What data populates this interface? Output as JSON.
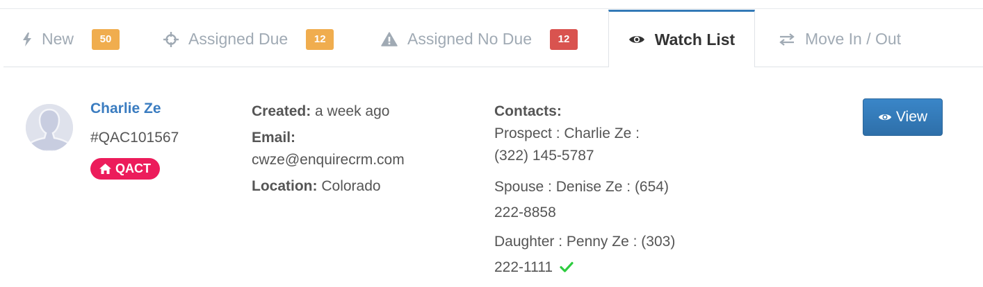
{
  "tabs": [
    {
      "label": "New",
      "icon": "bolt-icon",
      "badge": "50",
      "badge_color": "#f0ad4e"
    },
    {
      "label": "Assigned Due",
      "icon": "crosshairs-icon",
      "badge": "12",
      "badge_color": "#f0ad4e"
    },
    {
      "label": "Assigned No Due",
      "icon": "warning-icon",
      "badge": "12",
      "badge_color": "#d9534f"
    },
    {
      "label": "Watch List",
      "icon": "eye-icon",
      "active": true
    },
    {
      "label": "Move In / Out",
      "icon": "exchange-icon"
    }
  ],
  "record": {
    "name": "Charlie Ze",
    "code": "#QAC101567",
    "tag": "QACT",
    "tag_icon": "home-icon",
    "tag_color": "#ec1c5b",
    "created_label": "Created:",
    "created_value": "a week ago",
    "email_label": "Email:",
    "email_value": "cwze@enquirecrm.com",
    "location_label": "Location:",
    "location_value": "Colorado",
    "contacts_label": "Contacts:",
    "contacts": [
      {
        "line1": "Prospect : Charlie Ze :",
        "line2": "(322) 145-5787"
      },
      {
        "line1": "Spouse : Denise Ze : (654)",
        "line2": "222-8858"
      },
      {
        "line1": "Daughter : Penny Ze : (303)",
        "line2": "222-1111",
        "verified": true
      }
    ]
  },
  "actions": {
    "view_label": "View",
    "view_icon": "eye-icon"
  },
  "colors": {
    "accent": "#337ab7",
    "link": "#3a7cc0",
    "verified": "#2ecc40"
  }
}
